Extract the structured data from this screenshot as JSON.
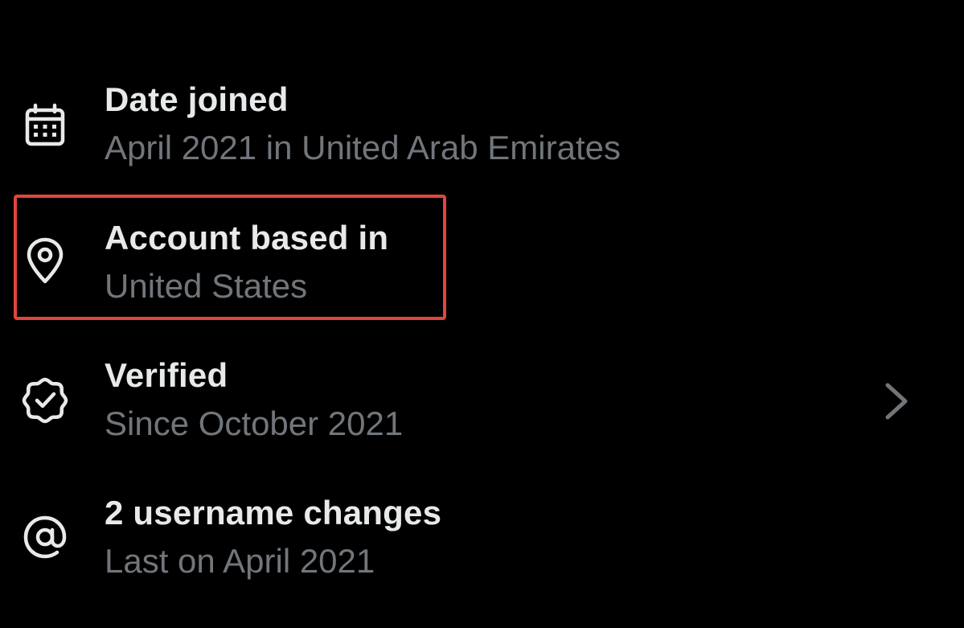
{
  "rows": [
    {
      "icon": "calendar-icon",
      "title": "Date joined",
      "subtitle": "April 2021 in United Arab Emirates"
    },
    {
      "icon": "location-pin-icon",
      "title": "Account based in",
      "subtitle": "United States"
    },
    {
      "icon": "verified-badge-icon",
      "title": "Verified",
      "subtitle": "Since October 2021",
      "has_chevron": true
    },
    {
      "icon": "at-sign-icon",
      "title": "2 username changes",
      "subtitle": "Last on April 2021"
    }
  ],
  "colors": {
    "background": "#000000",
    "title_text": "#e7e9ea",
    "subtitle_text": "#71767b",
    "icon": "#e7e9ea",
    "chevron": "#71767b",
    "highlight_border": "#e0463c"
  }
}
